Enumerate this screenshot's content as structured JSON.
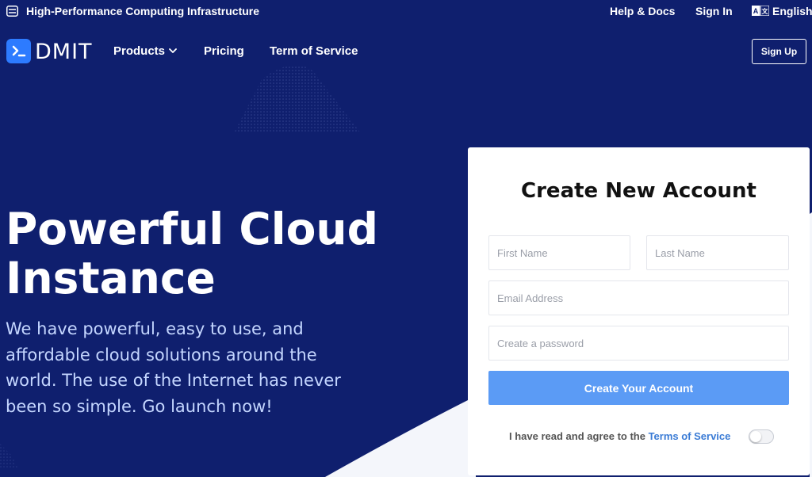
{
  "topbar": {
    "tagline": "High-Performance Computing Infrastructure",
    "tagline_icon": "server-icon",
    "help": "Help & Docs",
    "signin": "Sign In",
    "language_icon": "translate-icon",
    "language": "English"
  },
  "nav": {
    "logo_icon": "terminal-icon",
    "logo_text": "DMIT",
    "products": "Products",
    "pricing": "Pricing",
    "tos": "Term of Service",
    "signup": "Sign Up"
  },
  "hero": {
    "title_line1": "Powerful Cloud",
    "title_line2": "Instance",
    "text": "We have powerful, easy to use, and affordable cloud solutions around the world. The use of the Internet has never been so simple. Go launch now!"
  },
  "form": {
    "title": "Create New Account",
    "first_name_placeholder": "First Name",
    "last_name_placeholder": "Last Name",
    "email_placeholder": "Email Address",
    "password_placeholder": "Create a password",
    "submit": "Create Your Account",
    "agree_text": "I have read and agree to the ",
    "agree_link": "Terms of Service",
    "agree_toggle_on": false
  },
  "colors": {
    "background": "#0f1f6e",
    "logo_blue": "#2d7bff",
    "button_blue": "#5b9bf5",
    "link_blue": "#3a7bd5"
  }
}
